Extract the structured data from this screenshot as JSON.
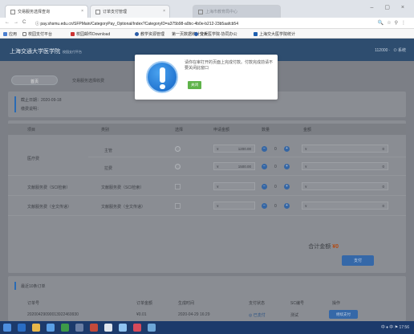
{
  "browser": {
    "tabs": [
      {
        "label": "交易服务选择查询",
        "active": true
      },
      {
        "label": "订单支付管理",
        "active": false
      },
      {
        "label": "上海市教育局中心",
        "active": false
      }
    ],
    "url": "pay.shsmu.edu.cn/SFPMain/CategoryPay_Optional/Index?CategoryID=a375b98-a0bc-4b0e-b212-23b5aafcb54",
    "bookmarks": [
      "应用",
      "校园支付平台",
      "校园邮件Download",
      "教学资源管理",
      "第一页数据统计分析",
      "交大医学院-协同办公",
      "上海交大医学院统计"
    ]
  },
  "site": {
    "title": "上海交通大学医学院",
    "subtitle": "校园支付平台",
    "header_right": [
      "112000 ·",
      "系统"
    ]
  },
  "breadcrumb": {
    "home": "首页",
    "current": "交易服务选择收费"
  },
  "info": {
    "deadline": "截止日期：2020-09-18",
    "note": "缴费说明："
  },
  "table": {
    "headers": [
      "项目",
      "类别",
      "选择",
      "申请金额",
      "数量",
      "金额"
    ],
    "rows": [
      {
        "group": "医疗费",
        "category": "主管",
        "price": "1200.00",
        "qty": "0",
        "amount": "0"
      },
      {
        "group": "",
        "category": "拉费",
        "price": "1500.00",
        "qty": "0",
        "amount": "0"
      },
      {
        "group": "文献服务费（SCI检索）",
        "category": "文献服务费（SCI检索）",
        "price": "",
        "qty": "0",
        "amount": "0"
      },
      {
        "group": "文献服务费（全文传递）",
        "category": "文献服务费（全文传递）",
        "price": "",
        "qty": "0",
        "amount": "0"
      }
    ],
    "currency": "¥",
    "total_label": "合计金额",
    "total_value": "¥0",
    "pay_label": "支付"
  },
  "orders": {
    "title": "最近10条订单",
    "headers": [
      "订单号",
      "订单金额",
      "生成时间",
      "支付状态",
      "SC编号",
      "操作"
    ],
    "rows": [
      {
        "id": "20200429090013922469930",
        "amount": "¥0.01",
        "time": "2020-04-29 16:29",
        "status": "已支付",
        "sc": "测试",
        "action": "继续支付"
      }
    ]
  },
  "modal": {
    "message": "请你在审打开的页面上完成付款。付款完成前请不要关闭此窗口",
    "ok_label": "关闭"
  },
  "taskbar": {
    "tray": "中 ♦ 中 ⚑ 17:56"
  }
}
